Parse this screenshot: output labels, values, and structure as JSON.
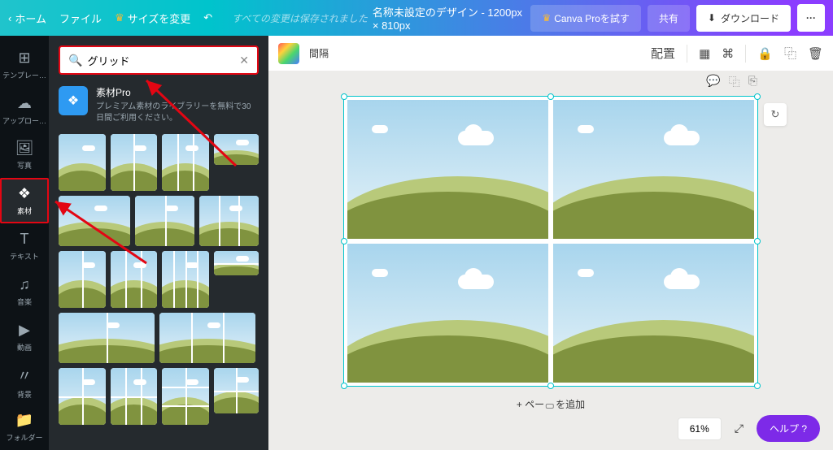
{
  "header": {
    "home": "ホーム",
    "file": "ファイル",
    "resize": "サイズを変更",
    "saved": "すべての変更は保存されました",
    "title": "名称未設定のデザイン - 1200px × 810px",
    "try_pro": "Canva Proを試す",
    "share": "共有",
    "download": "ダウンロード",
    "more": "···"
  },
  "rail": {
    "items": [
      {
        "icon": "⊞",
        "label": "テンプレー…"
      },
      {
        "icon": "☁",
        "label": "アップロー…"
      },
      {
        "icon": "🖼",
        "label": "写真"
      },
      {
        "icon": "❖",
        "label": "素材"
      },
      {
        "icon": "T",
        "label": "テキスト"
      },
      {
        "icon": "♫",
        "label": "音楽"
      },
      {
        "icon": "▶",
        "label": "動画"
      },
      {
        "icon": "〃",
        "label": "背景"
      },
      {
        "icon": "📁",
        "label": "フォルダー"
      }
    ]
  },
  "panel": {
    "search_value": "グリッド",
    "pro_title": "素材Pro",
    "pro_desc": "プレミアム素材のライブラリーを無料で30日間ご利用ください。"
  },
  "context": {
    "spacing": "間隔",
    "position": "配置"
  },
  "canvas": {
    "add_page_prefix": "+ ペー",
    "add_page_suffix": "を追加",
    "zoom": "61%",
    "help": "ヘルプ ?"
  }
}
